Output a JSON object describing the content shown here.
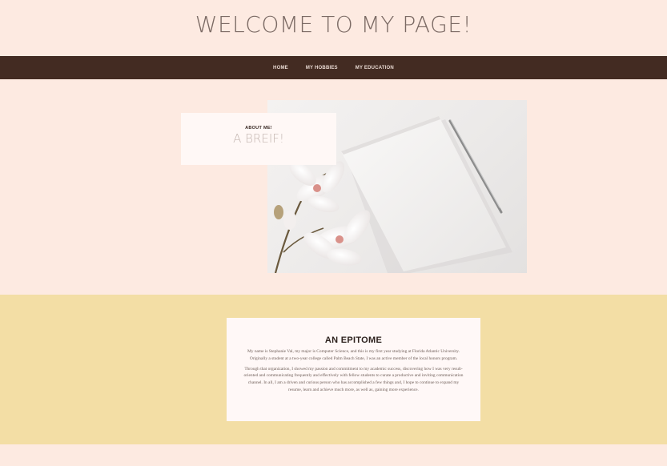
{
  "header": {
    "title": "WELCOME TO MY PAGE!"
  },
  "nav": {
    "items": [
      {
        "label": "HOME"
      },
      {
        "label": "MY HOBBIES"
      },
      {
        "label": "MY EDUCATION"
      }
    ]
  },
  "hero": {
    "label": "ABOUT ME!",
    "title": "A BREIF!"
  },
  "epitome": {
    "title": "AN EPITOME",
    "paragraphs": [
      "My name is Stephanie Val, my major is Computer Science, and this is my first year studying at Florida Atlantic University. Originally a student at a two-year college called Palm Beach State, I was an active member of the local honors program.",
      "Through that organization, I showed my passion and commitment to my academic success, discovering how I was very result-oriented and communicating frequently and effectively with fellow students to curate a productive and inviting communication channel. In all, I am a driven and curious person who has accomplished a few things and, I hope to continue to expand my resume, learn and achieve much more, as well as, gaining more experience."
    ]
  },
  "colors": {
    "background": "#fdeae1",
    "navbar": "#432b22",
    "band": "#f3dea5",
    "card": "#fff8f6"
  }
}
